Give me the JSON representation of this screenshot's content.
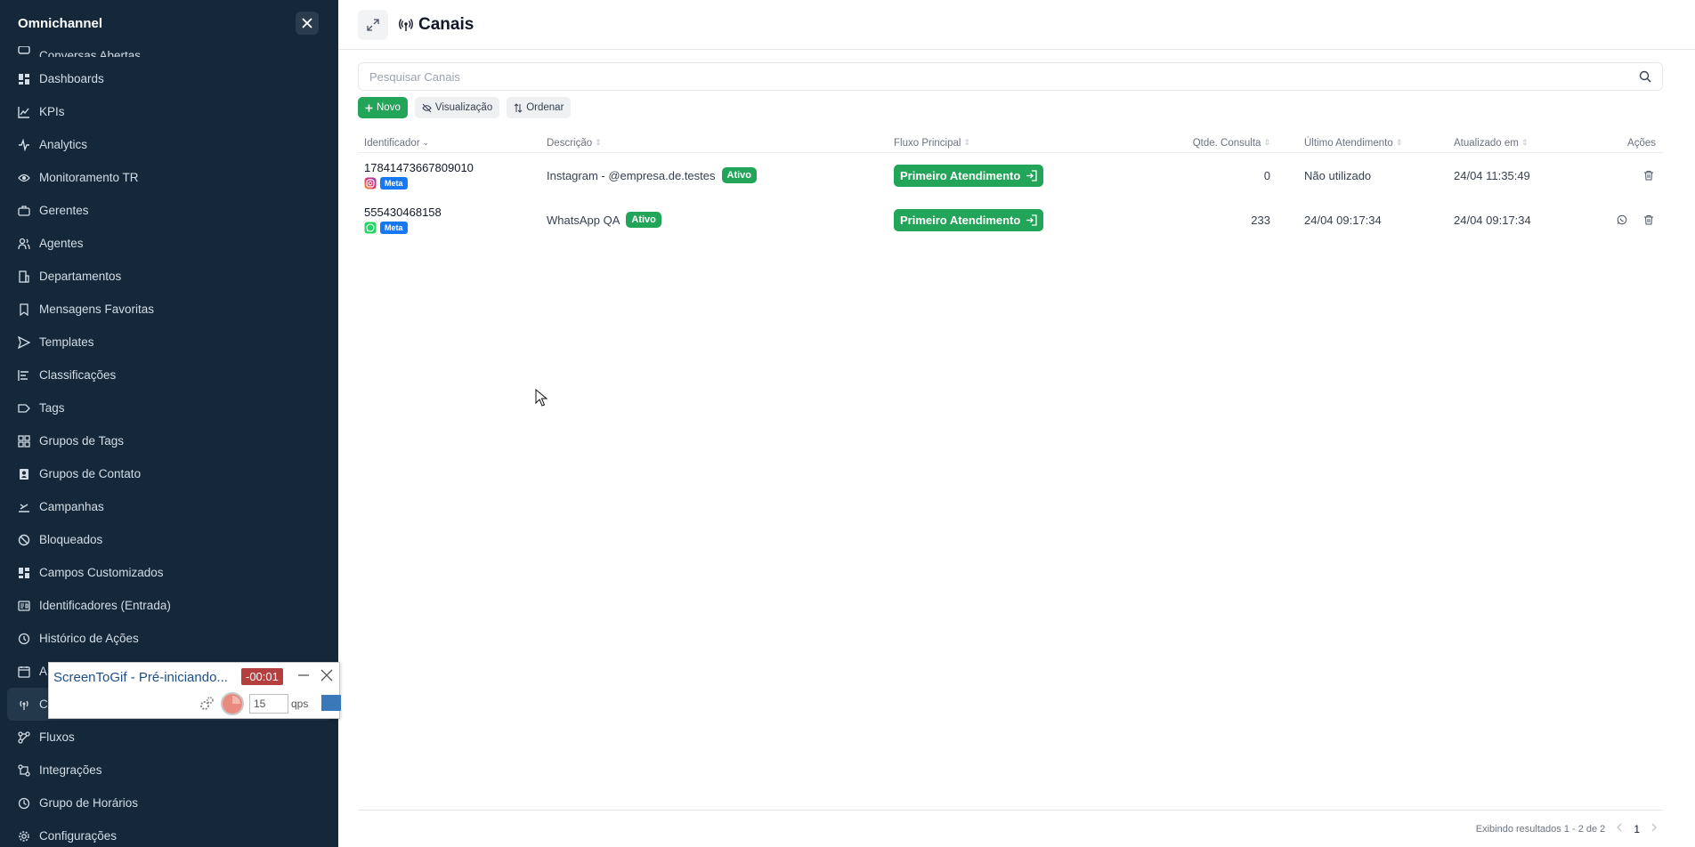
{
  "sidebar": {
    "title": "Omnichannel",
    "items": [
      {
        "label": "Conversas Abertas",
        "icon": "chat-icon"
      },
      {
        "label": "Dashboards",
        "icon": "dashboard-icon"
      },
      {
        "label": "KPIs",
        "icon": "line-chart-icon"
      },
      {
        "label": "Analytics",
        "icon": "activity-icon"
      },
      {
        "label": "Monitoramento TR",
        "icon": "eye-icon"
      },
      {
        "label": "Gerentes",
        "icon": "briefcase-icon"
      },
      {
        "label": "Agentes",
        "icon": "users-icon"
      },
      {
        "label": "Departamentos",
        "icon": "building-icon"
      },
      {
        "label": "Mensagens Favoritas",
        "icon": "bookmark-icon"
      },
      {
        "label": "Templates",
        "icon": "send-icon"
      },
      {
        "label": "Classificações",
        "icon": "bars-icon"
      },
      {
        "label": "Tags",
        "icon": "tag-icon"
      },
      {
        "label": "Grupos de Tags",
        "icon": "grid-icon"
      },
      {
        "label": "Grupos de Contato",
        "icon": "contact-book-icon"
      },
      {
        "label": "Campanhas",
        "icon": "campaign-icon"
      },
      {
        "label": "Bloqueados",
        "icon": "block-icon"
      },
      {
        "label": "Campos Customizados",
        "icon": "dashboard-icon"
      },
      {
        "label": "Identificadores (Entrada)",
        "icon": "id-card-icon"
      },
      {
        "label": "Histórico de Ações",
        "icon": "history-icon"
      },
      {
        "label": "A",
        "icon": "calendar-icon"
      },
      {
        "label": "C",
        "icon": "broadcast-icon"
      },
      {
        "label": "Fluxos",
        "icon": "flow-icon"
      },
      {
        "label": "Integrações",
        "icon": "integration-icon"
      },
      {
        "label": "Grupo de Horários",
        "icon": "clock-icon"
      },
      {
        "label": "Configurações",
        "icon": "gear-icon"
      }
    ]
  },
  "screentogif": {
    "title": "ScreenToGif - Pré-iniciando...",
    "timer": "-00:01",
    "fps": "15",
    "fps_label": "qps"
  },
  "header": {
    "title": "Canais"
  },
  "search": {
    "placeholder": "Pesquisar Canais"
  },
  "toolbar": {
    "new_label": "Novo",
    "view_label": "Visualização",
    "sort_label": "Ordenar"
  },
  "table": {
    "columns": [
      "Identificador",
      "Descrição",
      "Fluxo Principal",
      "Qtde. Consulta",
      "Último Atendimento",
      "Atualizado em",
      "Ações"
    ],
    "rows": [
      {
        "id": "17841473667809010",
        "provider": "Meta",
        "channel_icon": "instagram-icon",
        "description": "Instagram - @empresa.de.testes",
        "status": "Ativo",
        "flow": "Primeiro Atendimento",
        "count": "0",
        "last": "Não utilizado",
        "updated": "24/04 11:35:49"
      },
      {
        "id": "555430468158",
        "provider": "Meta",
        "channel_icon": "whatsapp-icon",
        "description": "WhatsApp QA",
        "status": "Ativo",
        "flow": "Primeiro Atendimento",
        "count": "233",
        "last": "24/04 09:17:34",
        "updated": "24/04 09:17:34"
      }
    ]
  },
  "footer": {
    "results": "Exibindo resultados 1 - 2 de 2",
    "page": "1"
  },
  "colors": {
    "sidebar_bg": "#14283a",
    "accent_green": "#22a559",
    "meta_blue": "#1877f2"
  }
}
